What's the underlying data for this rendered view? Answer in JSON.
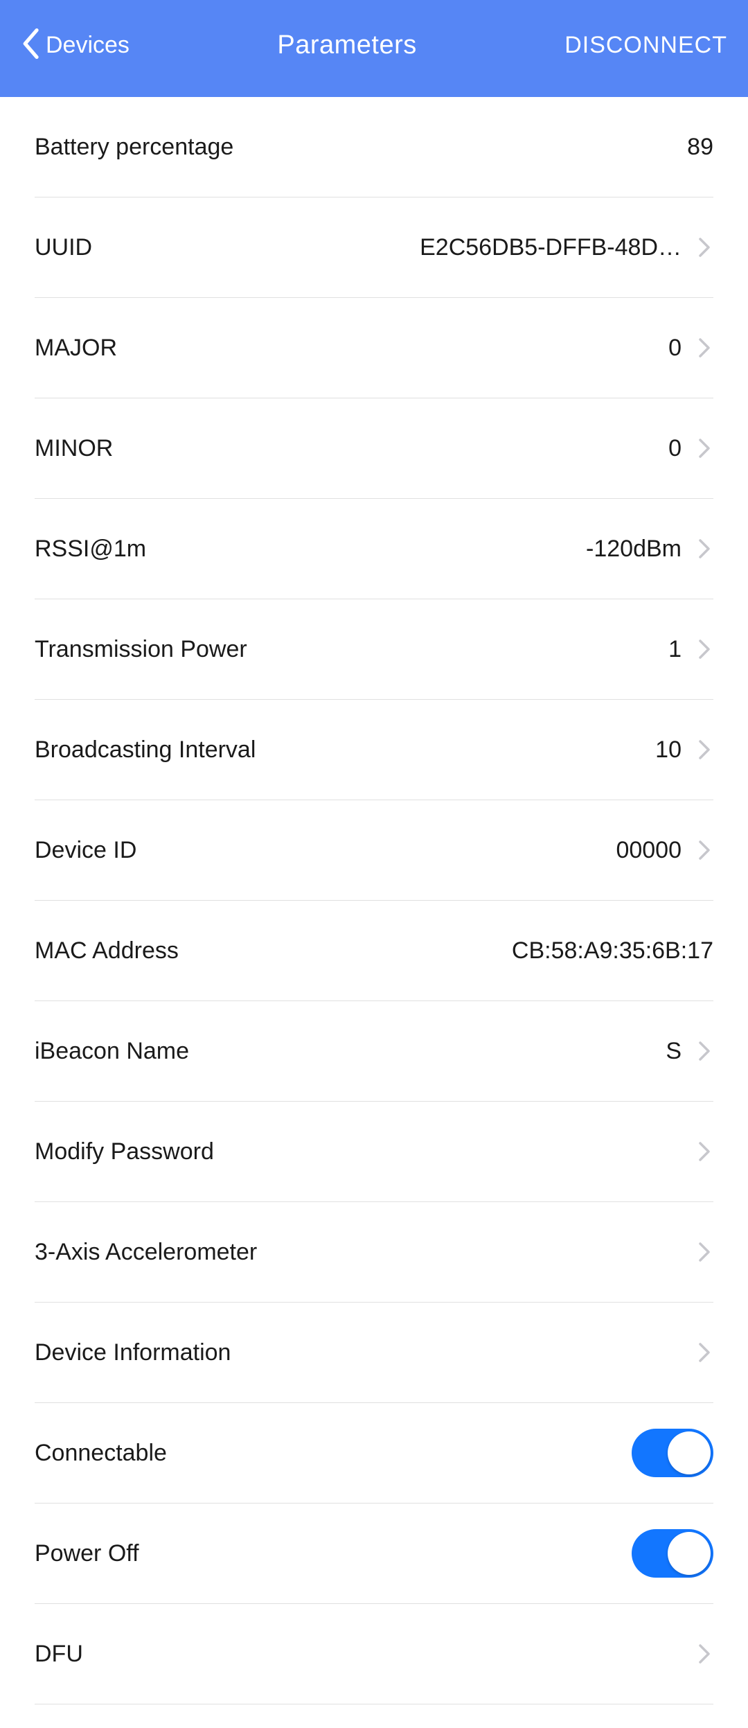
{
  "header": {
    "back_label": "Devices",
    "title": "Parameters",
    "action": "DISCONNECT"
  },
  "rows": {
    "battery": {
      "label": "Battery percentage",
      "value": "89"
    },
    "uuid": {
      "label": "UUID",
      "value": "E2C56DB5-DFFB-48D…"
    },
    "major": {
      "label": "MAJOR",
      "value": "0"
    },
    "minor": {
      "label": "MINOR",
      "value": "0"
    },
    "rssi": {
      "label": "RSSI@1m",
      "value": "-120dBm"
    },
    "txpower": {
      "label": "Transmission Power",
      "value": "1"
    },
    "interval": {
      "label": "Broadcasting Interval",
      "value": "10"
    },
    "deviceid": {
      "label": "Device ID",
      "value": "00000"
    },
    "mac": {
      "label": "MAC Address",
      "value": "CB:58:A9:35:6B:17"
    },
    "beaconname": {
      "label": "iBeacon Name",
      "value": "S"
    },
    "password": {
      "label": "Modify Password"
    },
    "accel": {
      "label": "3-Axis Accelerometer"
    },
    "devinfo": {
      "label": "Device Information"
    },
    "connectable": {
      "label": "Connectable",
      "on": true
    },
    "poweroff": {
      "label": "Power Off",
      "on": true
    },
    "dfu": {
      "label": "DFU"
    }
  }
}
